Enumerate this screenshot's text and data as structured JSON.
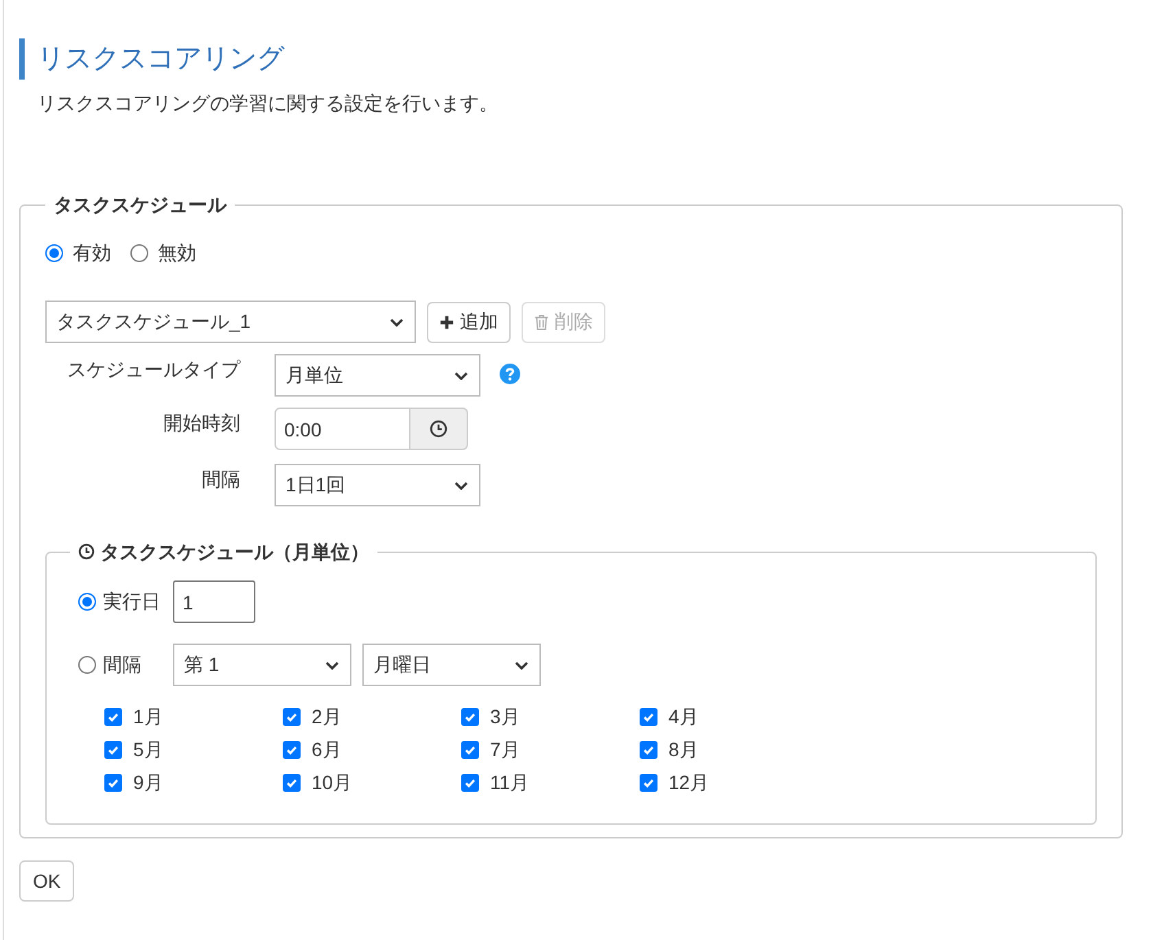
{
  "page": {
    "title": "リスクスコアリング",
    "description": "リスクスコアリングの学習に関する設定を行います。"
  },
  "task_schedule": {
    "legend": "タスクスケジュール",
    "status_options": [
      {
        "label": "有効",
        "selected": true
      },
      {
        "label": "無効",
        "selected": false
      }
    ],
    "schedule_select": {
      "value": "タスクスケジュール_1"
    },
    "add_button": {
      "label": "追加",
      "disabled": false
    },
    "delete_button": {
      "label": "削除",
      "disabled": true
    },
    "fields": [
      {
        "kind": "select",
        "label": "スケジュールタイプ",
        "value": "月単位",
        "help": true
      },
      {
        "kind": "time",
        "label": "開始時刻",
        "value": "0:00",
        "help": false
      },
      {
        "kind": "select",
        "label": "間隔",
        "value": "1日1回",
        "help": false
      }
    ],
    "monthly": {
      "legend": "タスクスケジュール（月単位）",
      "modes": [
        {
          "kind": "day",
          "label": "実行日",
          "selected": true,
          "value": "1"
        },
        {
          "kind": "interval",
          "label": "間隔",
          "selected": false,
          "week": "第 1",
          "weekday": "月曜日"
        }
      ],
      "months": [
        {
          "label": "1月",
          "checked": true
        },
        {
          "label": "2月",
          "checked": true
        },
        {
          "label": "3月",
          "checked": true
        },
        {
          "label": "4月",
          "checked": true
        },
        {
          "label": "5月",
          "checked": true
        },
        {
          "label": "6月",
          "checked": true
        },
        {
          "label": "7月",
          "checked": true
        },
        {
          "label": "8月",
          "checked": true
        },
        {
          "label": "9月",
          "checked": true
        },
        {
          "label": "10月",
          "checked": true
        },
        {
          "label": "11月",
          "checked": true
        },
        {
          "label": "12月",
          "checked": true
        }
      ]
    }
  },
  "buttons": [
    {
      "label": "OK"
    }
  ]
}
